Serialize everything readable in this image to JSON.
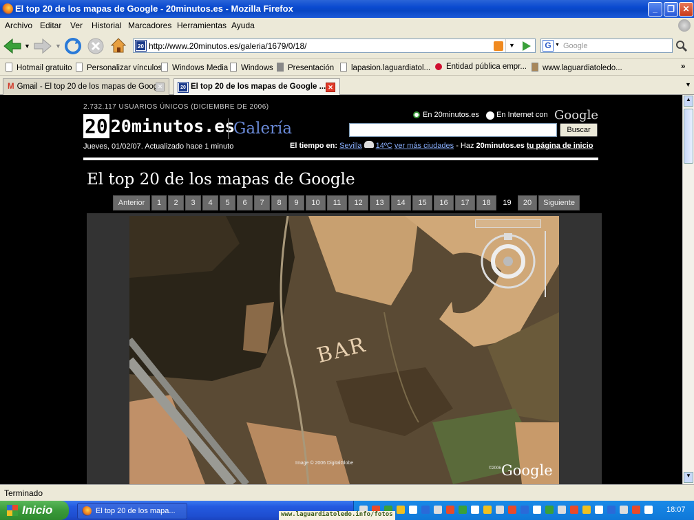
{
  "window": {
    "title": "El top 20 de los mapas de Google - 20minutos.es - Mozilla Firefox",
    "minimize": "_",
    "maximize": "❐",
    "close": "✕"
  },
  "menu": [
    "Archivo",
    "Editar",
    "Ver",
    "Historial",
    "Marcadores",
    "Herramientas",
    "Ayuda"
  ],
  "nav": {
    "url": "http://www.20minutos.es/galeria/1679/0/18/",
    "search_placeholder": "Google",
    "favicon_text": "20"
  },
  "bookmarks": [
    "Hotmail gratuito",
    "Personalizar vínculos",
    "Windows Media",
    "Windows",
    "Presentación",
    "lapasion.laguardiatol...",
    "Entidad pública empr...",
    "www.laguardiatoledo..."
  ],
  "tabs": [
    {
      "label": "Gmail - El top 20 de los mapas de Google"
    },
    {
      "label": "El top 20 de los mapas de Google ..."
    }
  ],
  "page": {
    "stats": "2.732.117 USUARIOS ÚNICOS (DICIEMBRE DE 2006)",
    "logo": "20minutos.es",
    "section": "Galería",
    "date": "Jueves, 01/02/07. Actualizado hace 1 minuto",
    "search_opt1": "En 20minutos.es",
    "search_opt2": "En Internet con",
    "google": "Google",
    "search_button": "Buscar",
    "weather_label": "El tiempo en:",
    "weather_city": "Sevilla",
    "weather_temp": "14ºC",
    "weather_more": "ver más ciudades",
    "home_prefix": "- Haz",
    "home_brand": "20minutos.es",
    "home_link": "tu página de inicio",
    "heading": "El top 20 de los mapas de Google",
    "pagination": {
      "prev": "Anterior",
      "next": "Siguiente",
      "pages": [
        "1",
        "2",
        "3",
        "4",
        "5",
        "6",
        "7",
        "8",
        "9",
        "10",
        "11",
        "12",
        "13",
        "14",
        "15",
        "16",
        "17",
        "18",
        "19",
        "20"
      ],
      "current": "19"
    },
    "map": {
      "text": "BAR",
      "credit": "Image © 2006 DigitalGlobe",
      "copyright": "©2006",
      "logo": "Google"
    }
  },
  "status": "Terminado",
  "taskbar": {
    "start": "Inicio",
    "item": "El top 20 de los mapa...",
    "clock": "18:07",
    "watermark": "www.laguardiatoledo.info/fotos"
  }
}
